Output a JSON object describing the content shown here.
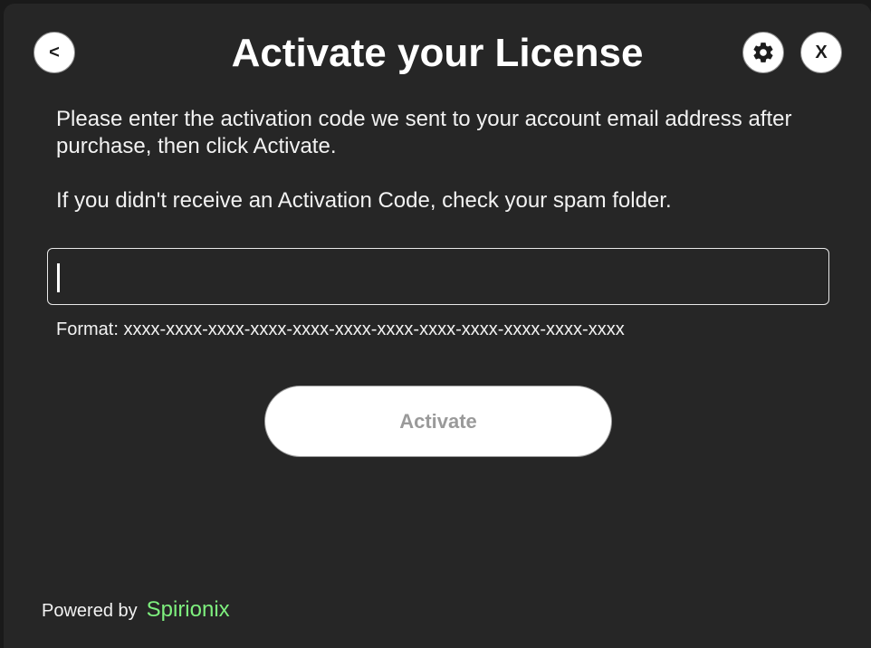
{
  "header": {
    "back_label": "<",
    "title": "Activate your License",
    "close_label": "X"
  },
  "instructions": {
    "paragraph1": "Please enter the activation code we sent to your account email address after purchase, then click Activate.",
    "paragraph2": "If you didn't receive an Activation Code, check your spam folder."
  },
  "activation_input": {
    "value": "",
    "placeholder": ""
  },
  "format_hint": "Format: xxxx-xxxx-xxxx-xxxx-xxxx-xxxx-xxxx-xxxx-xxxx-xxxx-xxxx-xxxx",
  "activate_button": {
    "label": "Activate",
    "enabled": false
  },
  "footer": {
    "powered_by": "Powered by",
    "brand": "Spirionix"
  },
  "colors": {
    "background": "#262626",
    "brand_accent": "#7ef07e",
    "disabled_text": "#9a9a9a"
  },
  "icons": {
    "back": "back-icon",
    "settings": "gear-icon",
    "close": "close-icon"
  }
}
